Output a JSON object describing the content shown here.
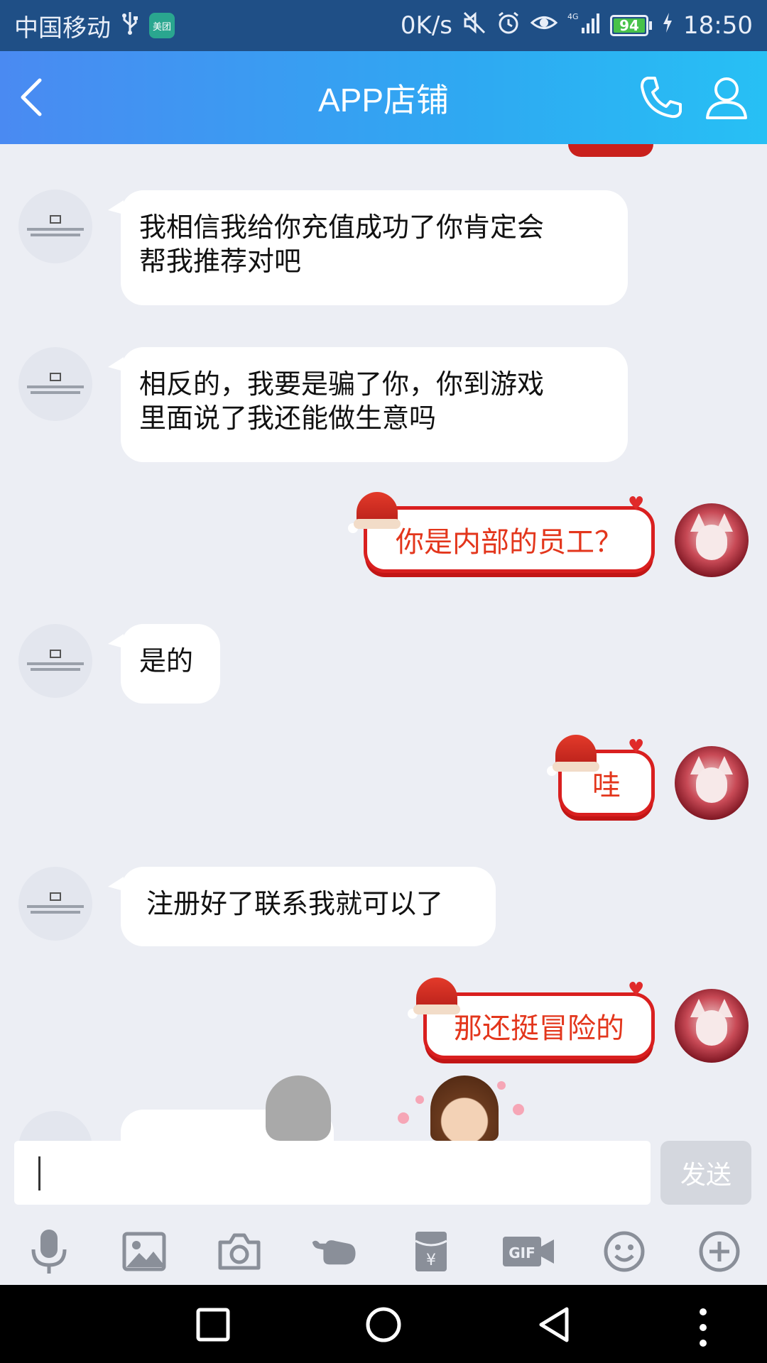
{
  "status_bar": {
    "carrier": "中国移动",
    "app_badge": "美团",
    "net_speed": "0K/s",
    "battery": "94",
    "time": "18:50"
  },
  "header": {
    "title": "APP店铺",
    "back_icon": "chevron-left-icon",
    "call_icon": "phone-icon",
    "profile_icon": "person-icon"
  },
  "messages": [
    {
      "from": "shop",
      "text_line1": "我相信我给你充值成功了你肯定会",
      "text_line2": "帮我推荐对吧"
    },
    {
      "from": "shop",
      "text_line1": "相反的，我要是骗了你，你到游戏",
      "text_line2": "里面说了我还能做生意吗"
    },
    {
      "from": "me",
      "text": "你是内部的员工？"
    },
    {
      "from": "shop",
      "text": "是的"
    },
    {
      "from": "me",
      "text": "哇"
    },
    {
      "from": "shop",
      "text": "注册好了联系我就可以了"
    },
    {
      "from": "me",
      "text": "那还挺冒险的"
    }
  ],
  "input": {
    "value": "",
    "send_label": "发送"
  },
  "toolbar": {
    "items": [
      "microphone-icon",
      "image-icon",
      "camera-icon",
      "poke-icon",
      "red-packet-icon",
      "gif-icon",
      "emoji-icon",
      "plus-icon"
    ]
  },
  "colors": {
    "header_gradient_start": "#4a8af2",
    "header_gradient_end": "#27c0f4",
    "outgoing_text": "#e3361c",
    "outgoing_border": "#d91f1f",
    "chat_background": "#eceef4"
  }
}
